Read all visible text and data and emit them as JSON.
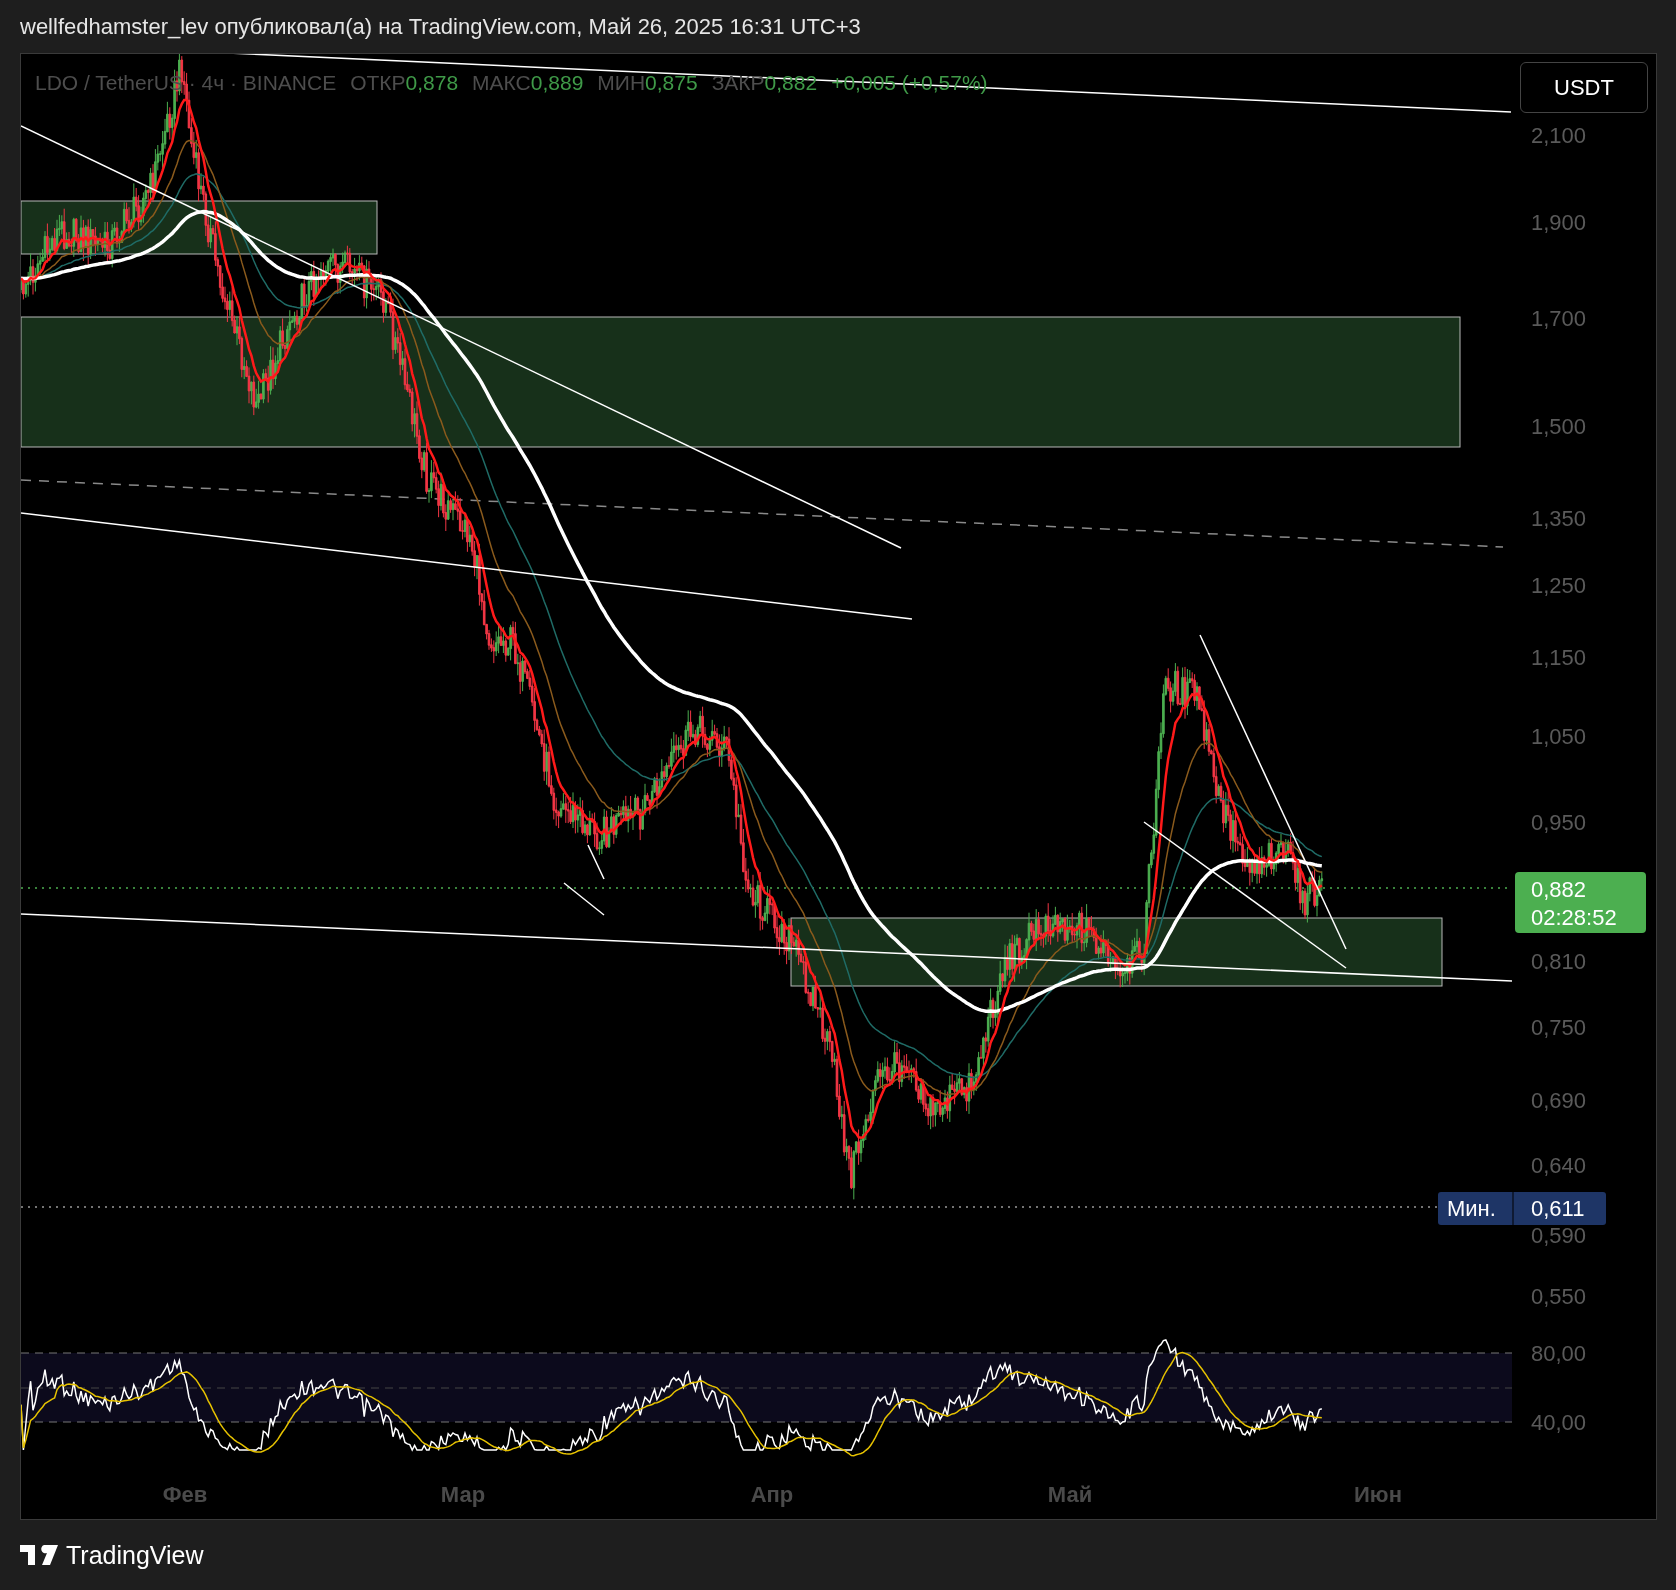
{
  "header": {
    "text": "wellfedhamster_lev опубликовал(а) на TradingView.com, Май 26, 2025 16:31 UTC+3"
  },
  "legend": {
    "symbol": "LDO / TetherUS · 4ч · BINANCE",
    "values": [
      {
        "label": "ОТКР",
        "value": "0,878"
      },
      {
        "label": "МАКС",
        "value": "0,889"
      },
      {
        "label": "МИН",
        "value": "0,875"
      },
      {
        "label": "ЗАКР",
        "value": "0,882"
      }
    ],
    "change": "+0,005 (+0,57%)"
  },
  "currency_button": "USDT",
  "price_axis": [
    "2,100",
    "1,900",
    "1,700",
    "1,500",
    "1,350",
    "1,250",
    "1,150",
    "1,050",
    "0,950",
    "0,810",
    "0,750",
    "0,690",
    "0,640",
    "0,590",
    "0,550"
  ],
  "last_price": {
    "price": "0,882",
    "countdown": "02:28:52"
  },
  "min_tag": {
    "label": "Мин.",
    "price": "0,611"
  },
  "rsi_axis": [
    "80,00",
    "40,00"
  ],
  "time_axis": [
    "Фев",
    "Мар",
    "Апр",
    "Май",
    "Июн"
  ],
  "footer": {
    "brand": "TradingView"
  }
}
